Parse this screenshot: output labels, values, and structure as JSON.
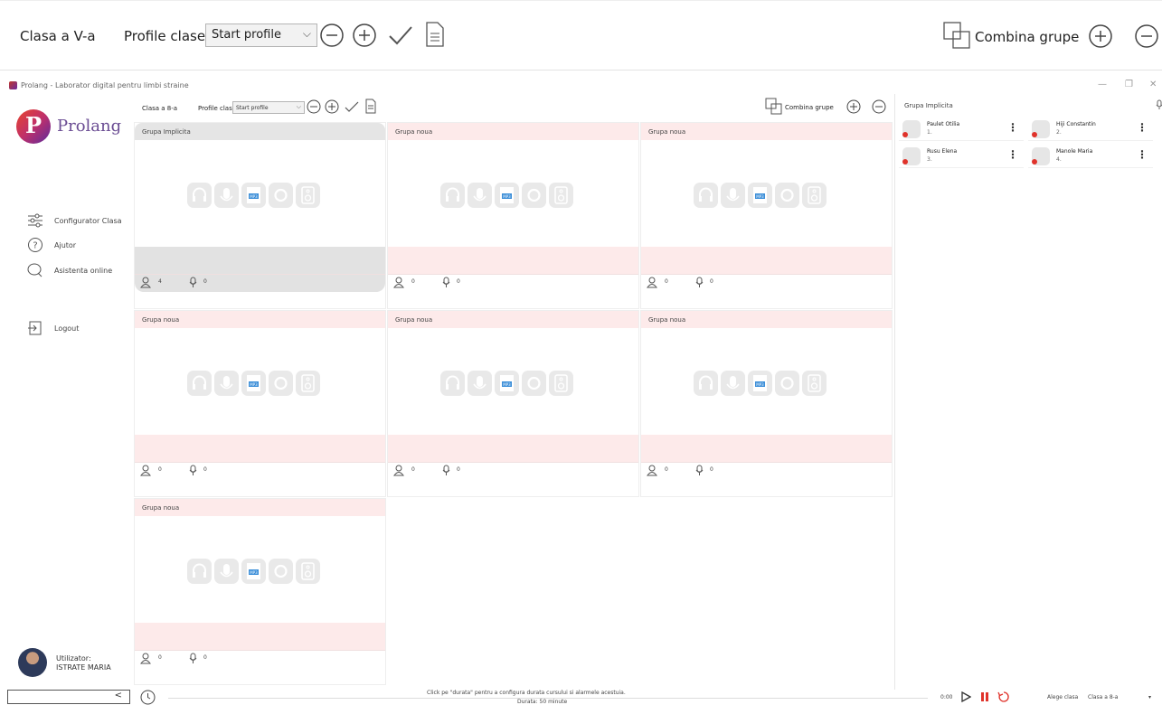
{
  "zoom_toolbar": {
    "class_label": "Clasa a V-a",
    "profile_label": "Profile clase",
    "profile_value": "Start profile",
    "combine_label": "Combina grupe"
  },
  "window": {
    "title": "Prolang - Laborator digital pentru limbi straine"
  },
  "sidebar": {
    "logo_text": "Prolang",
    "logo_letter": "P",
    "items": [
      {
        "label": "Configurator Clasa",
        "icon": "sliders-icon"
      },
      {
        "label": "Ajutor",
        "icon": "help-icon"
      },
      {
        "label": "Asistenta online",
        "icon": "chat-icon"
      },
      {
        "label": "Logout",
        "icon": "logout-icon"
      }
    ],
    "user_label": "Utilizator:",
    "user_name": "ISTRATE MARIA"
  },
  "toolbar": {
    "class_label": "Clasa a 8-a",
    "profile_label": "Profile clase",
    "profile_value": "Start profile",
    "combine_label": "Combina grupe"
  },
  "groups": [
    {
      "name": "Grupa Implicita",
      "students": "4",
      "mics": "0",
      "selected": true
    },
    {
      "name": "Grupa noua",
      "students": "0",
      "mics": "0",
      "selected": false
    },
    {
      "name": "Grupa noua",
      "students": "0",
      "mics": "0",
      "selected": false
    },
    {
      "name": "Grupa noua",
      "students": "0",
      "mics": "0",
      "selected": false
    },
    {
      "name": "Grupa noua",
      "students": "0",
      "mics": "0",
      "selected": false
    },
    {
      "name": "Grupa noua",
      "students": "0",
      "mics": "0",
      "selected": false
    },
    {
      "name": "Grupa noua",
      "students": "0",
      "mics": "0",
      "selected": false
    }
  ],
  "right_panel": {
    "title": "Grupa Implicita",
    "students": [
      {
        "name": "Paulet Otilia",
        "index": "1."
      },
      {
        "name": "Hiji Constantin",
        "index": "2."
      },
      {
        "name": "Rusu Elena",
        "index": "3."
      },
      {
        "name": "Manole Maria",
        "index": "4."
      }
    ]
  },
  "bottom_bar": {
    "hint": "Click pe \"durata\" pentru a configura durata cursului si alarmele acestuia.",
    "duration": "Durata: 50 minute",
    "time": "0:00",
    "choose_class_label": "Alege clasa",
    "class_value": "Clasa a 8-a",
    "nav_arrow": "<"
  },
  "colors": {
    "group_header_bg": "#fdeaea",
    "selected_group_bg": "#e2e2e2",
    "logo_purple": "#6a4c93",
    "status_red": "#e0332b"
  }
}
